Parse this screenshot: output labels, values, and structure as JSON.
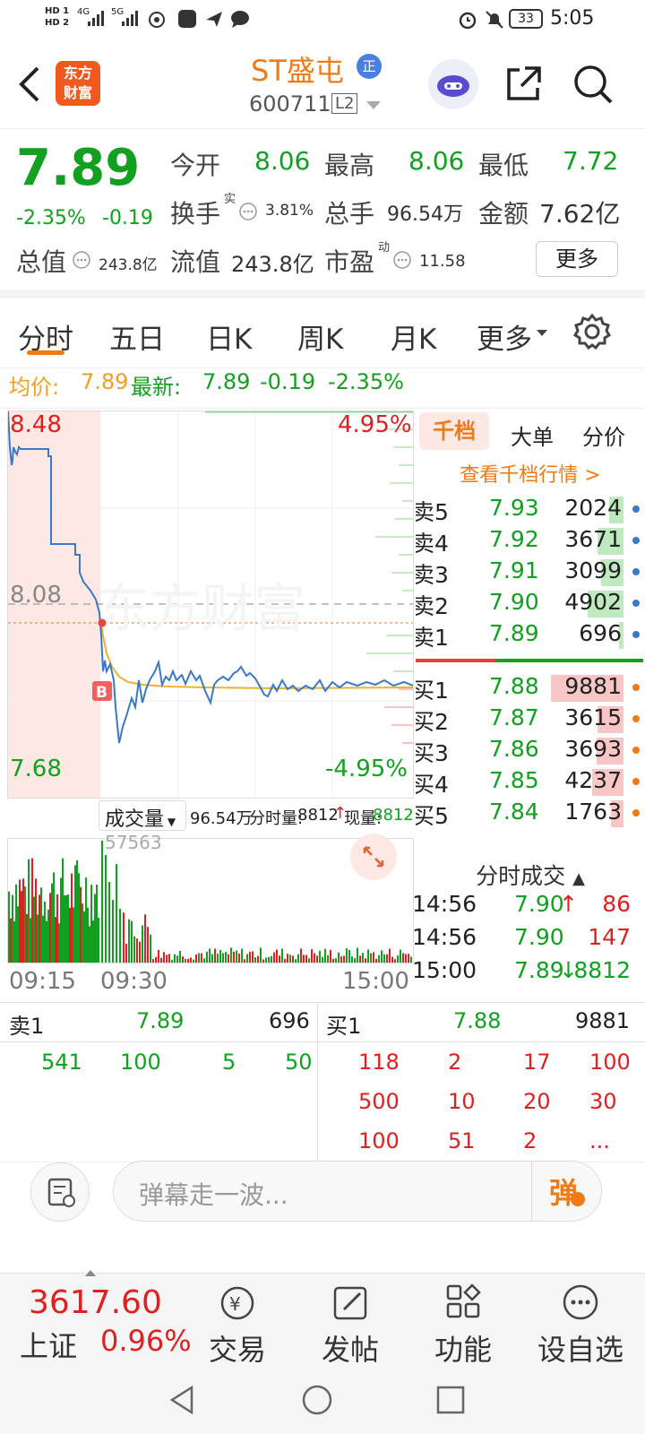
{
  "status": {
    "time": "5:05",
    "battery": "33",
    "sim1": "HD 1",
    "sim2": "HD 2",
    "net1": "4G",
    "net2": "5G"
  },
  "header": {
    "logo_line1": "东方",
    "logo_line2": "财富",
    "name": "ST盛屯",
    "badge": "正",
    "code": "600711",
    "level": "L2"
  },
  "quote": {
    "price": "7.89",
    "pct": "-2.35%",
    "chg": "-0.19",
    "open_label": "今开",
    "open": "8.06",
    "high_label": "最高",
    "high": "8.06",
    "low_label": "最低",
    "low": "7.72",
    "turnover_label": "换手",
    "turnover_sup": "实",
    "turnover": "3.81%",
    "vol_label": "总手",
    "vol": "96.54万",
    "amt_label": "金额",
    "amt": "7.62亿",
    "mcap_label": "总值",
    "mcap": "243.8亿",
    "float_label": "流值",
    "float": "243.8亿",
    "pe_label": "市盈",
    "pe_sup": "动",
    "pe": "11.58",
    "more": "更多"
  },
  "tabs": [
    "分时",
    "五日",
    "日K",
    "周K",
    "月K",
    "更多"
  ],
  "avgline": {
    "avg_label": "均价:",
    "avg": "7.89",
    "last_label": "最新:",
    "last": "7.89",
    "chg": "-0.19",
    "pct": "-2.35%"
  },
  "chart": {
    "y_top": "8.48",
    "y_mid": "8.08",
    "y_bot": "7.68",
    "pct_top": "4.95%",
    "pct_bot": "-4.95%",
    "watermark": "东方财富",
    "marker": "B"
  },
  "vol": {
    "label": "成交量",
    "total": "96.54万",
    "fen_label": "分时量:",
    "fen": "8812",
    "xian_label": "现量:",
    "xian": "8812",
    "peak": "57563"
  },
  "times": [
    "09:15",
    "09:30",
    "15:00"
  ],
  "book": {
    "tabs": [
      "千档",
      "大单",
      "分价"
    ],
    "link": "查看千档行情 >",
    "asks": [
      {
        "l": "卖5",
        "p": "7.93",
        "v": "2024",
        "w": 0.15
      },
      {
        "l": "卖4",
        "p": "7.92",
        "v": "3671",
        "w": 0.27
      },
      {
        "l": "卖3",
        "p": "7.91",
        "v": "3099",
        "w": 0.23
      },
      {
        "l": "卖2",
        "p": "7.90",
        "v": "4902",
        "w": 0.37
      },
      {
        "l": "卖1",
        "p": "7.89",
        "v": "696",
        "w": 0.05
      }
    ],
    "bids": [
      {
        "l": "买1",
        "p": "7.88",
        "v": "9881",
        "w": 0.75
      },
      {
        "l": "买2",
        "p": "7.87",
        "v": "3615",
        "w": 0.27
      },
      {
        "l": "买3",
        "p": "7.86",
        "v": "3693",
        "w": 0.28
      },
      {
        "l": "买4",
        "p": "7.85",
        "v": "4237",
        "w": 0.32
      },
      {
        "l": "买5",
        "p": "7.84",
        "v": "1763",
        "w": 0.13
      }
    ]
  },
  "ticks": {
    "title": "分时成交",
    "rows": [
      {
        "t": "14:56",
        "p": "7.90",
        "a": "↑",
        "v": "86"
      },
      {
        "t": "14:56",
        "p": "7.90",
        "a": "",
        "v": "147"
      },
      {
        "t": "15:00",
        "p": "7.89",
        "a": "↓",
        "v": "8812"
      }
    ]
  },
  "level1": {
    "sell_label": "卖1",
    "sell_p": "7.89",
    "sell_v": "696",
    "buy_label": "买1",
    "buy_p": "7.88",
    "buy_v": "9881",
    "sell_orders": [
      "541",
      "100",
      "5",
      "50"
    ],
    "buy_orders": [
      "118",
      "2",
      "17",
      "100",
      "500",
      "10",
      "20",
      "30",
      "100",
      "51",
      "2",
      "..."
    ]
  },
  "danmu": {
    "placeholder": "弹幕走一波...",
    "send": "弹"
  },
  "bottom": {
    "index_val": "3617.60",
    "index_name": "上证",
    "index_pct": "0.96%",
    "items": [
      "交易",
      "发帖",
      "功能",
      "设自选"
    ]
  }
}
